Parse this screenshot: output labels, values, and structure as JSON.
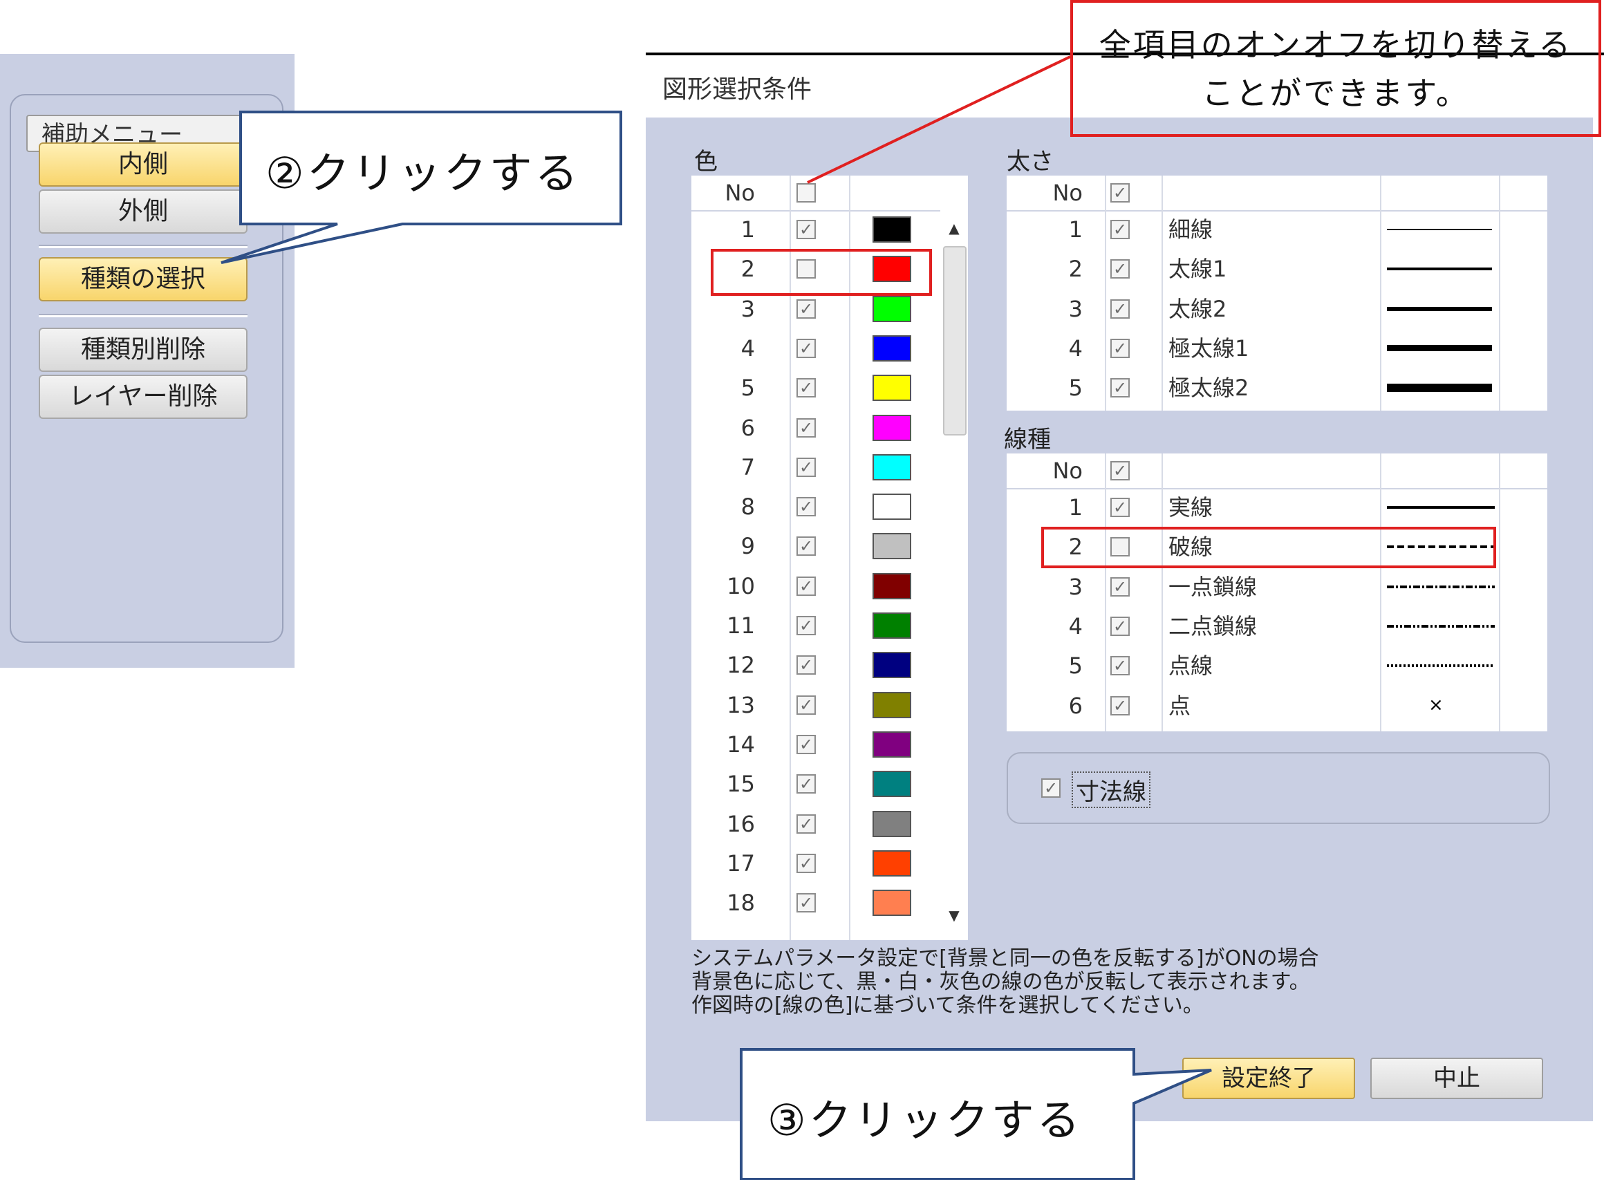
{
  "assist_menu": {
    "title": "補助メニュー",
    "buttons": {
      "inner": "内側",
      "outer": "外側",
      "select_type": "種類の選択",
      "delete_by_type": "種類別削除",
      "delete_layer": "レイヤー削除"
    }
  },
  "dialog": {
    "title": "図形選択条件",
    "color_section": {
      "label": "色",
      "header_no": "No",
      "rows": [
        {
          "no": "1",
          "checked": true,
          "color": "#000000"
        },
        {
          "no": "2",
          "checked": false,
          "color": "#ff0000"
        },
        {
          "no": "3",
          "checked": true,
          "color": "#00ff00"
        },
        {
          "no": "4",
          "checked": true,
          "color": "#0000ff"
        },
        {
          "no": "5",
          "checked": true,
          "color": "#ffff00"
        },
        {
          "no": "6",
          "checked": true,
          "color": "#ff00ff"
        },
        {
          "no": "7",
          "checked": true,
          "color": "#00ffff"
        },
        {
          "no": "8",
          "checked": true,
          "color": "#ffffff"
        },
        {
          "no": "9",
          "checked": true,
          "color": "#c0c0c0"
        },
        {
          "no": "10",
          "checked": true,
          "color": "#800000"
        },
        {
          "no": "11",
          "checked": true,
          "color": "#008000"
        },
        {
          "no": "12",
          "checked": true,
          "color": "#000080"
        },
        {
          "no": "13",
          "checked": true,
          "color": "#808000"
        },
        {
          "no": "14",
          "checked": true,
          "color": "#800080"
        },
        {
          "no": "15",
          "checked": true,
          "color": "#008080"
        },
        {
          "no": "16",
          "checked": true,
          "color": "#808080"
        },
        {
          "no": "17",
          "checked": true,
          "color": "#ff4000"
        },
        {
          "no": "18",
          "checked": true,
          "color": "#ff7f50"
        }
      ]
    },
    "weight_section": {
      "label": "太さ",
      "header_no": "No",
      "rows": [
        {
          "no": "1",
          "label": "細線"
        },
        {
          "no": "2",
          "label": "太線1"
        },
        {
          "no": "3",
          "label": "太線2"
        },
        {
          "no": "4",
          "label": "極太線1"
        },
        {
          "no": "5",
          "label": "極太線2"
        }
      ]
    },
    "linetype_section": {
      "label": "線種",
      "header_no": "No",
      "rows": [
        {
          "no": "1",
          "label": "実線",
          "checked": true
        },
        {
          "no": "2",
          "label": "破線",
          "checked": false
        },
        {
          "no": "3",
          "label": "一点鎖線",
          "checked": true
        },
        {
          "no": "4",
          "label": "二点鎖線",
          "checked": true
        },
        {
          "no": "5",
          "label": "点線",
          "checked": true
        },
        {
          "no": "6",
          "label": "点",
          "checked": true
        }
      ]
    },
    "dimension_label": "寸法線",
    "note_lines": [
      "システムパラメータ設定で[背景と同一の色を反転する]がONの場合",
      "背景色に応じて、黒・白・灰色の線の色が反転して表示されます。",
      "作図時の[線の色]に基づいて条件を選択してください。"
    ],
    "ok_button": "設定終了",
    "cancel_button": "中止"
  },
  "annotations": {
    "step2": "②クリックする",
    "step3": "③クリックする",
    "toggle_note_line1": "全項目のオンオフを切り替える",
    "toggle_note_line2": "ことができます。",
    "highlight_color": "#e02020",
    "callout_border_color": "#2f4f86"
  }
}
